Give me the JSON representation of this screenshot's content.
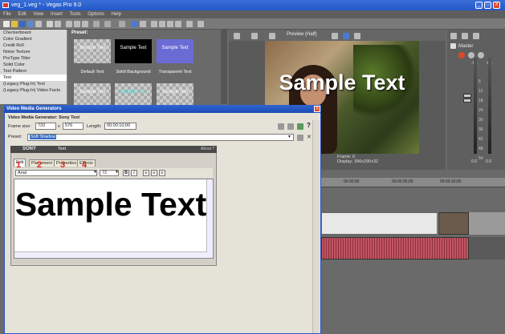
{
  "app": {
    "title": "veg_1.veg * - Vegas Pro 9.0",
    "menu": [
      "File",
      "Edit",
      "View",
      "Insert",
      "Tools",
      "Options",
      "Help"
    ],
    "window_buttons": [
      "_",
      "□",
      "X"
    ]
  },
  "generators": {
    "items": [
      "Checkerboard",
      "Color Gradient",
      "Credit Roll",
      "Noise Texture",
      "ProType Titler",
      "Solid Color",
      "Test Pattern",
      "Text",
      "(Legacy Plug-In) Text",
      "(Legacy Plug-In) Video Facto"
    ],
    "selected": "Text"
  },
  "presets": {
    "label": "Preset:",
    "tiles": [
      {
        "text": "Sample Text",
        "name": "Default Text"
      },
      {
        "text": "Sample Text",
        "name": "Solid Background"
      },
      {
        "text": "Sample Text",
        "name": "Transparent Text"
      },
      {
        "text": "Sample Text",
        "name": ""
      },
      {
        "text": "Sample Text",
        "name": ""
      },
      {
        "text": "Sample Text",
        "name": ""
      }
    ]
  },
  "preview": {
    "mode": "Preview (Half)",
    "overlay_text": "Sample Text",
    "frame_label": "Frame:",
    "frame_value": "0",
    "display_label": "Display:",
    "display_value": "396x290x32"
  },
  "mixer": {
    "title": "Master",
    "db_left": "-Inf.",
    "db_right": "-Inf.",
    "scale": [
      "6",
      "12",
      "18",
      "24",
      "30",
      "36",
      "42",
      "48",
      "54"
    ],
    "bottom_left": "0.0",
    "bottom_right": "0.0"
  },
  "timeline": {
    "ticks": [
      "00:00:00",
      "00:00:05;00",
      "00:00:10;00"
    ]
  },
  "dialog": {
    "title": "Video Media Generators",
    "subtitle": "Video Media Generator: Sony Text",
    "frame_size_label": "Frame size:",
    "frame_w": "720",
    "frame_x": "x",
    "frame_h": "576",
    "length_label": "Length:",
    "length_value": "00:00:10;00",
    "preset_label": "Preset:",
    "preset_value": "Soft Shadow",
    "close": "X",
    "inner": {
      "logo": "SONY",
      "header": "Text",
      "about": "About ?",
      "tabs": [
        "Edit",
        "Placement",
        "Properties",
        "Effects"
      ],
      "numbers": [
        "1",
        "2",
        "3",
        "4"
      ],
      "font": "Arial",
      "size": "72",
      "bold": "B",
      "italic": "I",
      "editor_text": "Sample Text"
    }
  }
}
